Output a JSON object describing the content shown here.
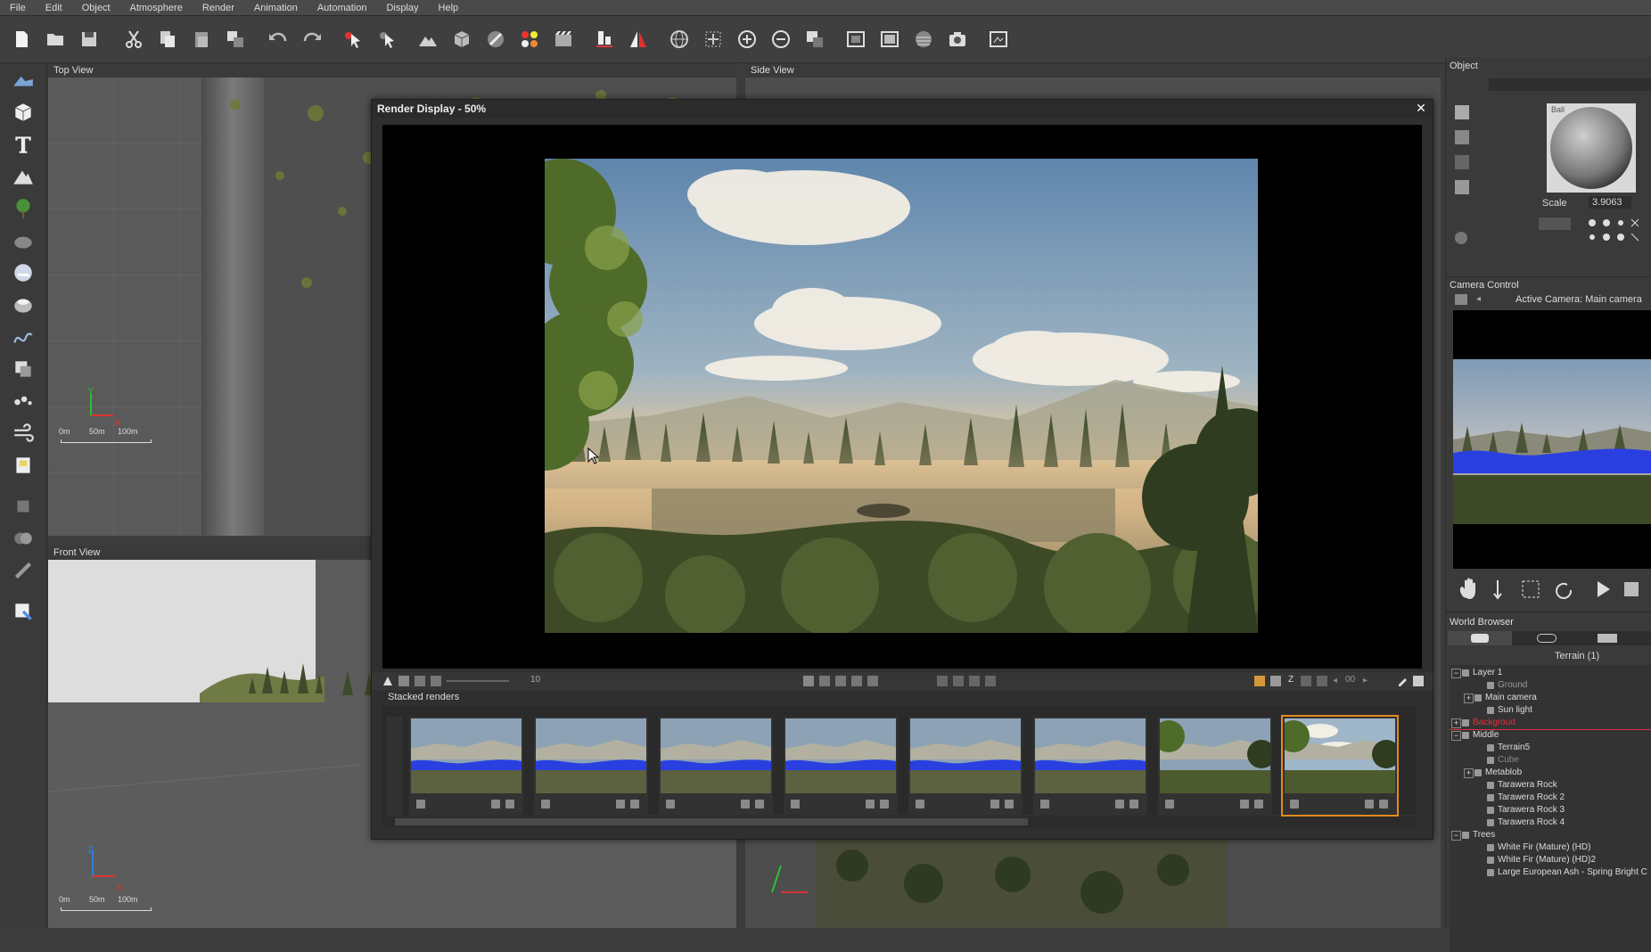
{
  "menu": [
    "File",
    "Edit",
    "Object",
    "Atmosphere",
    "Render",
    "Animation",
    "Automation",
    "Display",
    "Help"
  ],
  "toolbar_icons": [
    "new-icon",
    "open-icon",
    "save-icon",
    "cut-icon",
    "copy-icon",
    "paste-icon",
    "duplicate-icon",
    "undo-icon",
    "redo-icon",
    "select-icon",
    "select-arrow-icon",
    "terrain-icon",
    "cube-icon",
    "brush-icon",
    "spheres-icon",
    "film-icon",
    "align-icon",
    "mirror-icon",
    "globe-icon",
    "move-icon",
    "plus-icon",
    "minus-icon",
    "fit-icon",
    "frame-icon",
    "screen-icon",
    "sky-icon",
    "camera-icon",
    "render-options-icon"
  ],
  "left_tools": [
    "terrain-tool-icon",
    "cube-tool-icon",
    "text-tool-icon",
    "mountain-tool-icon",
    "tree-tool-icon",
    "rock-tool-icon",
    "cloud-tool-icon",
    "sphere-tool-icon",
    "path-tool-icon",
    "block-tool-icon",
    "dots-tool-icon",
    "wind-tool-icon",
    "light-tool-icon",
    "scatter-tool-icon",
    "group-tool-icon",
    "link-tool-icon",
    "export-tool-icon"
  ],
  "viewports": {
    "top_view": {
      "title": "Top View",
      "axis_y": "Y",
      "axis_x": "X",
      "scale": [
        "0m",
        "50m",
        "100m"
      ]
    },
    "front_view": {
      "title": "Front View",
      "axis_y": "Z",
      "axis_x": "X",
      "scale": [
        "0m",
        "50m",
        "100m"
      ]
    },
    "side_view": {
      "title": "Side View"
    }
  },
  "render_display": {
    "title": "Render Display - 50%",
    "close": "✕",
    "frame_value": "10",
    "stacked_label": "Stacked renders",
    "thumbs": 8,
    "toolbar_right_value": "00",
    "z_label": "Z"
  },
  "object_panel": {
    "title": "Object",
    "scale_label": "Scale",
    "scale_value": "3.9063",
    "material_name": "Ball"
  },
  "camera_control": {
    "title": "Camera Control",
    "active_camera": "Active Camera: Main camera"
  },
  "world_browser": {
    "title": "World Browser",
    "terrain_label": "Terrain (1)",
    "items": [
      {
        "label": "Layer 1",
        "indent": 0,
        "expander": "−",
        "color": "#dddddd"
      },
      {
        "label": "Ground",
        "indent": 2,
        "expander": "",
        "color": "#9a9a9a"
      },
      {
        "label": "Main camera",
        "indent": 1,
        "expander": "+",
        "color": "#dddddd"
      },
      {
        "label": "Sun light",
        "indent": 2,
        "expander": "",
        "color": "#dddddd"
      },
      {
        "label": "Backgroud",
        "indent": 0,
        "expander": "+",
        "color": "#e0303a"
      },
      {
        "label": "Middle",
        "indent": 0,
        "expander": "−",
        "color": "#dddddd"
      },
      {
        "label": "Terrain5",
        "indent": 2,
        "expander": "",
        "color": "#dddddd"
      },
      {
        "label": "Cube",
        "indent": 2,
        "expander": "",
        "color": "#8a8a8a"
      },
      {
        "label": "Metablob",
        "indent": 1,
        "expander": "+",
        "color": "#dddddd"
      },
      {
        "label": "Tarawera Rock",
        "indent": 2,
        "expander": "",
        "color": "#dddddd"
      },
      {
        "label": "Tarawera Rock 2",
        "indent": 2,
        "expander": "",
        "color": "#dddddd"
      },
      {
        "label": "Tarawera Rock 3",
        "indent": 2,
        "expander": "",
        "color": "#dddddd"
      },
      {
        "label": "Tarawera Rock 4",
        "indent": 2,
        "expander": "",
        "color": "#dddddd"
      },
      {
        "label": "Trees",
        "indent": 0,
        "expander": "−",
        "color": "#dddddd"
      },
      {
        "label": "White Fir (Mature) (HD)",
        "indent": 2,
        "expander": "",
        "color": "#dddddd"
      },
      {
        "label": "White Fir (Mature) (HD)2",
        "indent": 2,
        "expander": "",
        "color": "#dddddd"
      },
      {
        "label": "Large European Ash - Spring Bright C",
        "indent": 2,
        "expander": "",
        "color": "#dddddd"
      }
    ]
  },
  "colors": {
    "accent_orange": "#e38a1d",
    "selection_blue": "#1f6fd0",
    "water_blue": "#2a3fe0"
  }
}
